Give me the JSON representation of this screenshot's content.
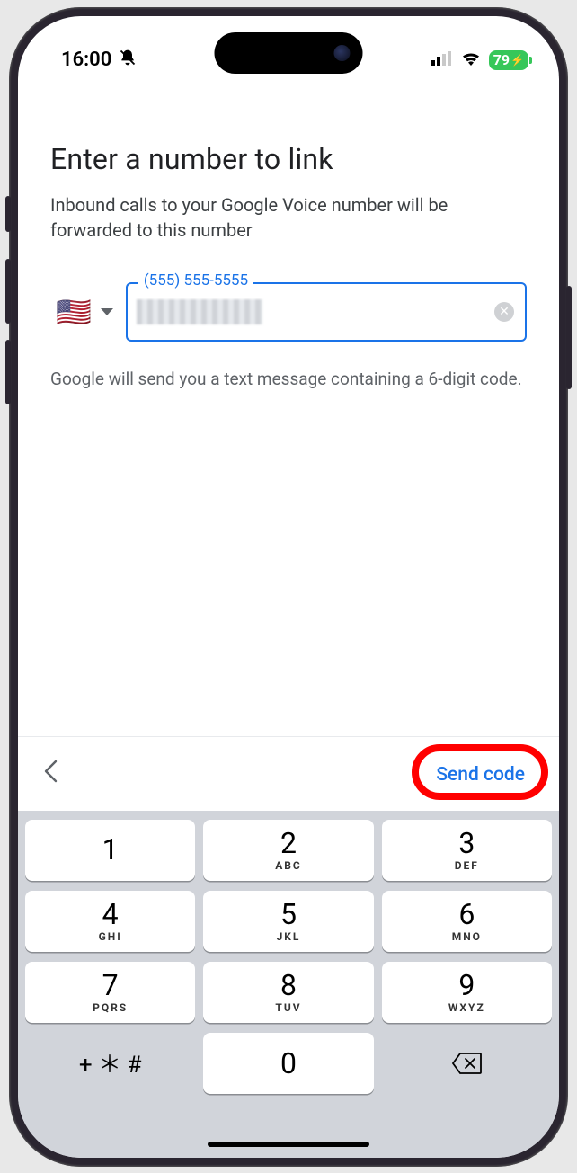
{
  "status": {
    "time": "16:00",
    "battery": "79"
  },
  "page": {
    "title": "Enter a number to link",
    "subtitle": "Inbound calls to your Google Voice number will be forwarded to this number",
    "input_label": "(555) 555-5555",
    "helper": "Google will send you a text message containing a 6-digit code."
  },
  "country": {
    "flag": "🇺🇸"
  },
  "actions": {
    "send_code": "Send code"
  },
  "keypad": {
    "k1": {
      "d": "1",
      "l": ""
    },
    "k2": {
      "d": "2",
      "l": "ABC"
    },
    "k3": {
      "d": "3",
      "l": "DEF"
    },
    "k4": {
      "d": "4",
      "l": "GHI"
    },
    "k5": {
      "d": "5",
      "l": "JKL"
    },
    "k6": {
      "d": "6",
      "l": "MNO"
    },
    "k7": {
      "d": "7",
      "l": "PQRS"
    },
    "k8": {
      "d": "8",
      "l": "TUV"
    },
    "k9": {
      "d": "9",
      "l": "WXYZ"
    },
    "k0": {
      "d": "0",
      "l": ""
    },
    "symbols": "+ ＊ #"
  }
}
